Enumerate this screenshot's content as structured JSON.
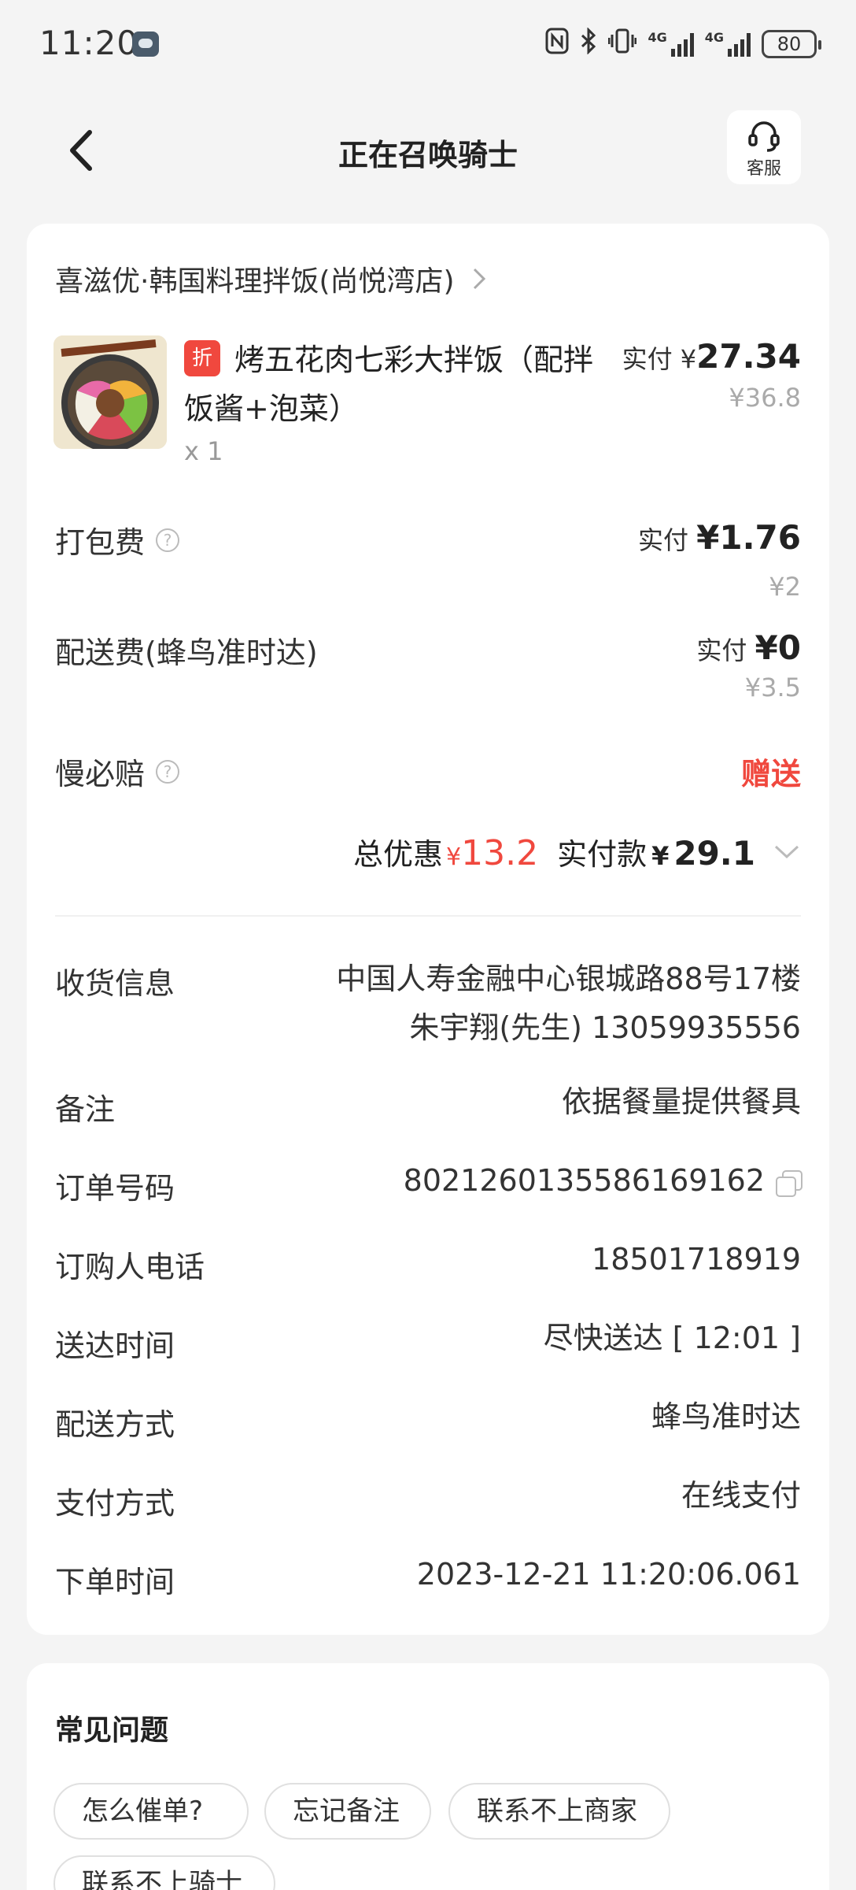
{
  "status_bar": {
    "time": "11:20",
    "network_1": "4G",
    "network_2": "4G",
    "battery": "80"
  },
  "header": {
    "title": "正在召唤骑士",
    "service_label": "客服"
  },
  "order": {
    "store_name": "喜滋优·韩国料理拌饭(尚悦湾店)",
    "item": {
      "badge": "折",
      "name": "烤五花肉七彩大拌饭（配拌饭酱+泡菜）",
      "qty": "x 1",
      "paid_label": "实付",
      "paid_symbol": "¥",
      "paid_amount": "27.34",
      "original_price": "¥36.8"
    },
    "packing": {
      "label": "打包费",
      "paid_label": "实付",
      "paid_amount": "¥1.76",
      "original": "¥2"
    },
    "delivery": {
      "label": "配送费(蜂鸟准时达)",
      "paid_label": "实付",
      "paid_amount": "¥0",
      "original": "¥3.5"
    },
    "late_compensation": {
      "label": "慢必赔",
      "value": "赠送"
    },
    "totals": {
      "discount_label": "总优惠",
      "discount_symbol": "¥",
      "discount_amount": "13.2",
      "pay_label": "实付款",
      "pay_symbol": "¥",
      "pay_amount": "29.1"
    },
    "info": [
      {
        "label": "收货信息",
        "value_line1": "中国人寿金融中心银城路88号17楼",
        "value_line2": "朱宇翔(先生) 13059935556"
      },
      {
        "label": "备注",
        "value": "依据餐量提供餐具"
      },
      {
        "label": "订单号码",
        "value": "8021260135586169162"
      },
      {
        "label": "订购人电话",
        "value": "18501718919"
      },
      {
        "label": "送达时间",
        "value": "尽快送达 [ 12:01 ]"
      },
      {
        "label": "配送方式",
        "value": "蜂鸟准时达"
      },
      {
        "label": "支付方式",
        "value": "在线支付"
      },
      {
        "label": "下单时间",
        "value": "2023-12-21 11:20:06.061"
      }
    ]
  },
  "faq": {
    "title": "常见问题",
    "chips": [
      "怎么催单?",
      "忘记备注",
      "联系不上商家",
      "联系不上骑士"
    ]
  },
  "colors": {
    "accent_red": "#f0483e",
    "background": "#f4f4f4"
  }
}
